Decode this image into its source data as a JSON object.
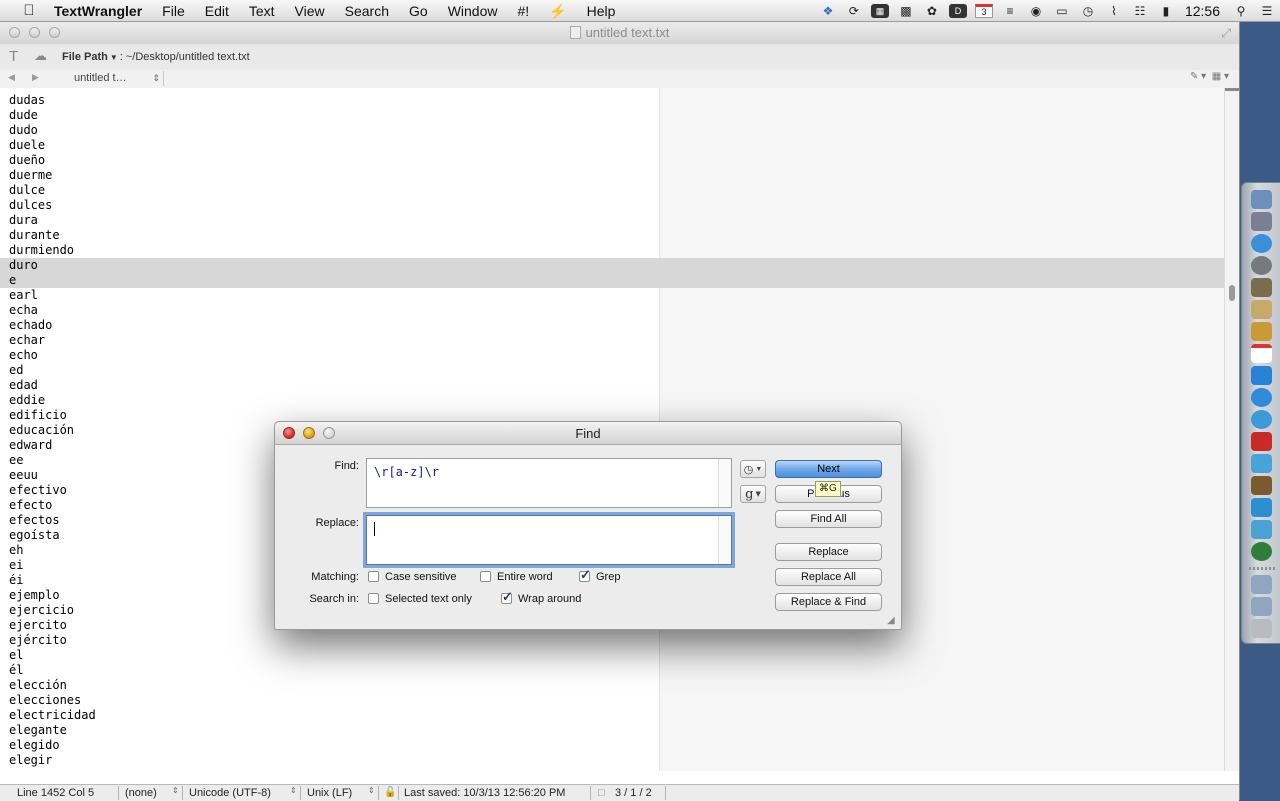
{
  "menubar": {
    "apple": "",
    "items": [
      "TextWrangler",
      "File",
      "Edit",
      "Text",
      "View",
      "Search",
      "Go",
      "Window",
      "#!",
      "Help"
    ],
    "bolt_icon": "bolt-icon",
    "calendar_day": "3",
    "clock": "12:56"
  },
  "window": {
    "title": "untitled text.txt",
    "filepath_label": "File Path",
    "filepath_value": ": ~/Desktop/untitled text.txt",
    "doc_menu": "untitled t…"
  },
  "editor": {
    "lines": [
      "dudas",
      "dude",
      "dudo",
      "duele",
      "dueño",
      "duerme",
      "dulce",
      "dulces",
      "dura",
      "durante",
      "durmiendo",
      "duro",
      "e",
      "earl",
      "echa",
      "echado",
      "echar",
      "echo",
      "ed",
      "edad",
      "eddie",
      "edificio",
      "educación",
      "edward",
      "ee",
      "eeuu",
      "efectivo",
      "efecto",
      "efectos",
      "egoísta",
      "eh",
      "ei",
      "éi",
      "ejemplo",
      "ejercicio",
      "ejercito",
      "ejército",
      "el",
      "él",
      "elección",
      "elecciones",
      "electricidad",
      "elegante",
      "elegido",
      "elegir"
    ]
  },
  "status": {
    "position": "Line 1452 Col 5",
    "language": "(none)",
    "encoding": "Unicode (UTF-8)",
    "line_endings": "Unix (LF)",
    "last_saved": "Last saved: 10/3/13 12:56:20 PM",
    "counts": "3 / 1 / 2"
  },
  "find": {
    "title": "Find",
    "find_label": "Find:",
    "find_value": "\\r[a-z]\\r",
    "replace_label": "Replace:",
    "replace_value": "",
    "grep_button": "g",
    "matching_label": "Matching:",
    "search_in_label": "Search in:",
    "options": {
      "case_sensitive": "Case sensitive",
      "entire_word": "Entire word",
      "grep": "Grep",
      "selected_text_only": "Selected text only",
      "wrap_around": "Wrap around"
    },
    "buttons": {
      "next": "Next",
      "previous": "Previous",
      "find_all": "Find All",
      "replace": "Replace",
      "replace_all": "Replace All",
      "replace_find": "Replace & Find"
    },
    "tooltip": "⌘G"
  }
}
